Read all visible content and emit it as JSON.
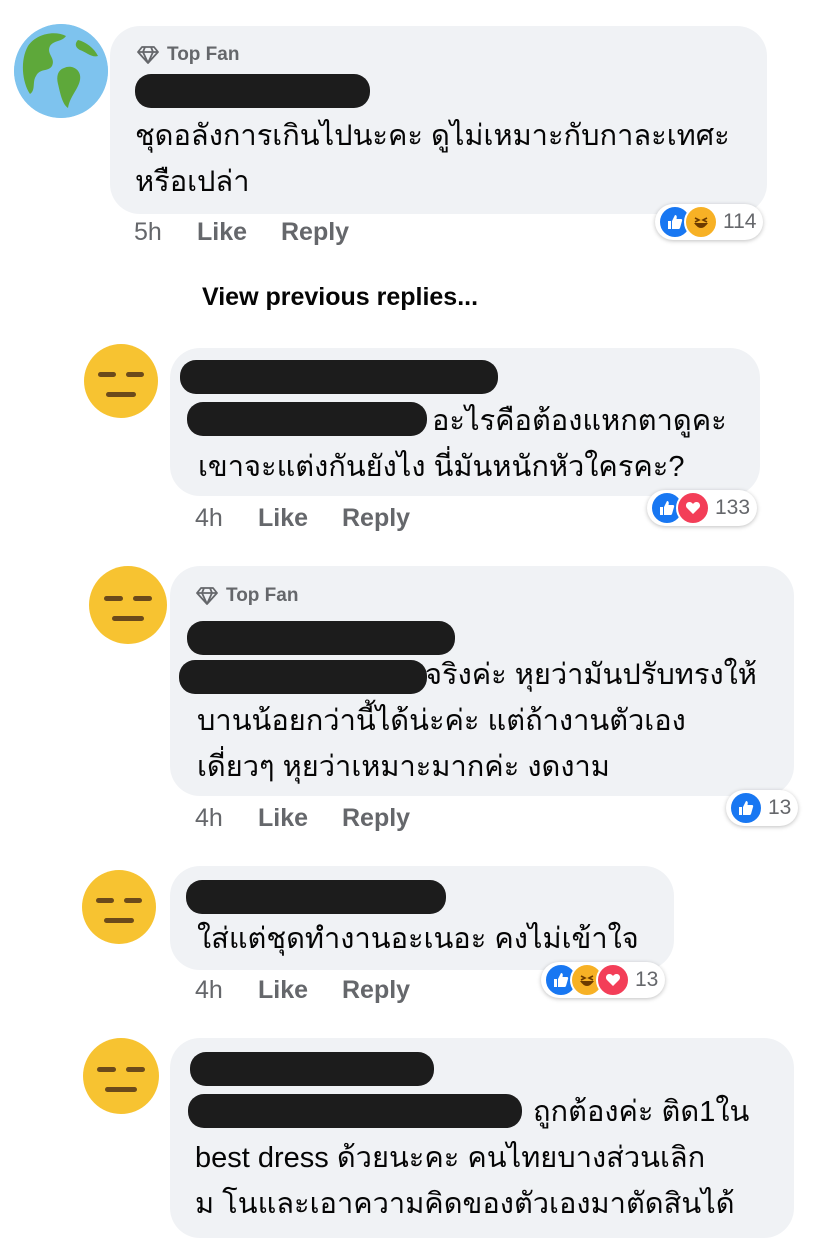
{
  "labels": {
    "top_fan": "Top Fan",
    "like": "Like",
    "reply": "Reply"
  },
  "view_previous_replies": "View previous replies...",
  "comments": [
    {
      "avatar": "globe-avatar",
      "top_fan": true,
      "text_lines": [
        "ชุดอลังการเกินไปนะคะ ดูไม่เหมาะกับกาละเทศะ",
        "หรือเปล่า"
      ],
      "time": "5h",
      "reactions": [
        "like",
        "haha"
      ],
      "reaction_count": "114"
    },
    {
      "avatar": "expressionless-face-avatar",
      "top_fan": false,
      "text_lines": [
        "อะไรคือต้องแหกตาดูคะ",
        "เขาจะแต่งกันยังไง นี่มันหนักหัวใครคะ?"
      ],
      "time": "4h",
      "reactions": [
        "like",
        "love"
      ],
      "reaction_count": "133"
    },
    {
      "avatar": "expressionless-face-avatar",
      "top_fan": true,
      "text_lines": [
        "จริงค่ะ หุยว่ามันปรับทรงให้",
        "บานน้อยกว่านี้ได้น่ะค่ะ แต่ถ้างานตัวเอง",
        "เดี่ยวๆ หุยว่าเหมาะมากค่ะ งดงาม"
      ],
      "time": "4h",
      "reactions": [
        "like"
      ],
      "reaction_count": "13"
    },
    {
      "avatar": "expressionless-face-avatar",
      "top_fan": false,
      "text_lines": [
        "ใส่แต่ชุดทำงานอะเนอะ คงไม่เข้าใจ"
      ],
      "time": "4h",
      "reactions": [
        "like",
        "haha",
        "love"
      ],
      "reaction_count": "13"
    },
    {
      "avatar": "expressionless-face-avatar",
      "top_fan": false,
      "text_lines": [
        "ถูกต้องค่ะ ติด1ใน",
        "best dress ด้วยนะคะ คนไทยบางส่วนเลิก",
        "ม โนและเอาความคิดของตัวเองมาตัดสินได้"
      ],
      "time": "",
      "reactions": [],
      "reaction_count": ""
    }
  ],
  "colors": {
    "bubble": "#f0f2f5",
    "like_blue": "#1877f2",
    "love_red": "#f33e58",
    "haha_yellow": "#f7b125",
    "meta_gray": "#65676b"
  }
}
